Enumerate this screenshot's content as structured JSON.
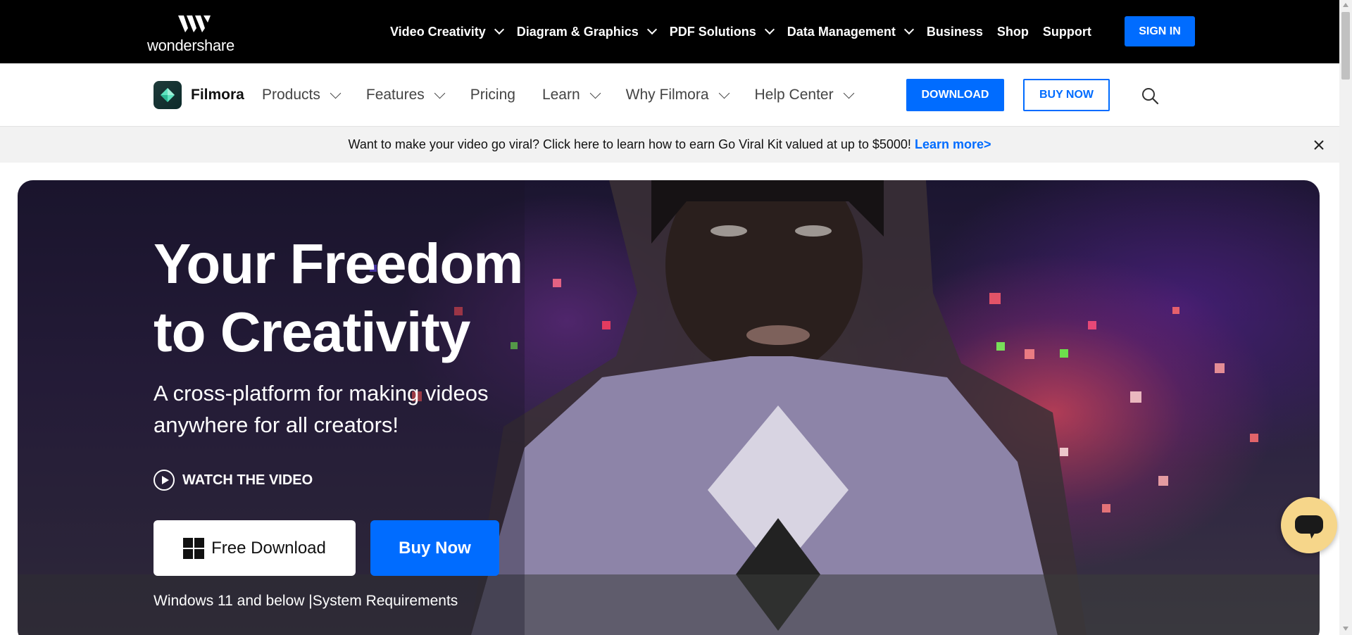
{
  "topbar": {
    "brand": "wondershare",
    "logo_icon": "wondershare-logo-icon",
    "nav": [
      {
        "label": "Video Creativity",
        "dropdown": true
      },
      {
        "label": "Diagram & Graphics",
        "dropdown": true
      },
      {
        "label": "PDF Solutions",
        "dropdown": true
      },
      {
        "label": "Data Management",
        "dropdown": true
      },
      {
        "label": "Business",
        "dropdown": false
      },
      {
        "label": "Shop",
        "dropdown": false
      },
      {
        "label": "Support",
        "dropdown": false
      }
    ],
    "sign_in": "SIGN IN"
  },
  "product_nav": {
    "product_name": "Filmora",
    "product_icon": "filmora-logo-icon",
    "items": [
      {
        "label": "Products",
        "dropdown": true
      },
      {
        "label": "Features",
        "dropdown": true
      },
      {
        "label": "Pricing",
        "dropdown": false
      },
      {
        "label": "Learn",
        "dropdown": true
      },
      {
        "label": "Why Filmora",
        "dropdown": true
      },
      {
        "label": "Help Center",
        "dropdown": true
      }
    ],
    "download": "DOWNLOAD",
    "buy_now": "BUY NOW",
    "search_icon": "search-icon"
  },
  "promo": {
    "text": "Want to make your video go viral? Click here to learn how to earn Go Viral Kit valued at up to $5000!",
    "link": "Learn more>",
    "close_icon": "close-icon"
  },
  "hero": {
    "title_line1": "Your Freedom",
    "title_line2": "to Creativity",
    "subtitle": "A cross-platform for making videos anywhere for all creators!",
    "watch_video": "WATCH THE VIDEO",
    "free_download": "Free Download",
    "buy_now": "Buy Now",
    "requirements_prefix": "Windows 11 and below",
    "requirements_separator": "|",
    "requirements_link": "System Requirements"
  },
  "colors": {
    "accent": "#006cff",
    "topbar_bg": "#000000",
    "promo_bg": "#f2f2f2",
    "chat_bg": "#f6d68a"
  },
  "chat": {
    "icon": "chat-icon"
  }
}
